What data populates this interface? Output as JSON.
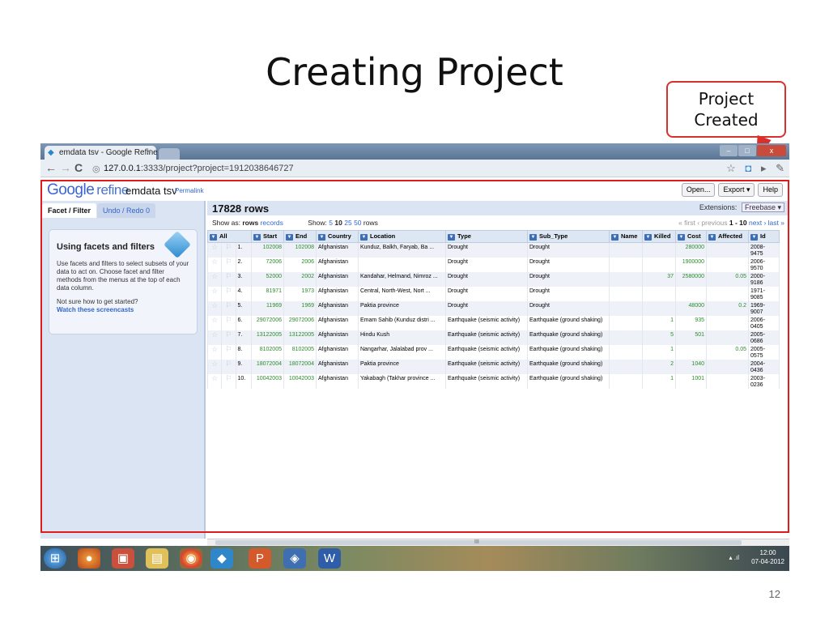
{
  "slide": {
    "title": "Creating Project",
    "callout": "Project Created",
    "page_number": "12"
  },
  "browser": {
    "tab_title": "emdata tsv - Google Refine",
    "tab_close": "×",
    "url_host": "127.0.0.1",
    "url_rest": ":3333/project?project=1912038646727"
  },
  "refine": {
    "logo": "Google",
    "logo_suffix": "refine",
    "project_name": "emdata tsv",
    "permalink": "Permalink",
    "buttons": {
      "open": "Open...",
      "export": "Export ▾",
      "help": "Help"
    },
    "left_tabs": {
      "facet": "Facet / Filter",
      "undo": "Undo / Redo 0"
    },
    "facet_box": {
      "title": "Using facets and filters",
      "text1": "Use facets and filters to select subsets of your data to act on. Choose facet and filter methods from the menus at the top of each data column.",
      "text2": "Not sure how to get started?",
      "link": "Watch these screencasts"
    },
    "row_count": "17828 rows",
    "extensions_label": "Extensions:",
    "extensions_value": "Freebase ▾",
    "show_as_label": "Show as:",
    "show_as_rows": "rows",
    "show_as_records": "records",
    "show_label": "Show:",
    "page_sizes": [
      "5",
      "10",
      "25",
      "50"
    ],
    "page_size_selected": "10",
    "rows_word": "rows",
    "pager": {
      "first": "« first",
      "previous": "‹ previous",
      "range": "1 - 10",
      "next": "next ›",
      "last": "last »"
    },
    "columns": [
      "All",
      "Start",
      "End",
      "Country",
      "Location",
      "Type",
      "Sub_Type",
      "Name",
      "Killed",
      "Cost",
      "Affected",
      "Id"
    ],
    "rows": [
      {
        "n": "1.",
        "start": "102008",
        "end": "102008",
        "country": "Afghanistan",
        "location": "Kunduz, Balkh, Faryab, Ba ...",
        "type": "Drought",
        "subtype": "Drought",
        "name": "",
        "killed": "",
        "cost": "280000",
        "affected": "",
        "id": [
          "2008-",
          "9475"
        ]
      },
      {
        "n": "2.",
        "start": "72006",
        "end": "2006",
        "country": "Afghanistan",
        "location": "",
        "type": "Drought",
        "subtype": "Drought",
        "name": "",
        "killed": "",
        "cost": "1900000",
        "affected": "",
        "id": [
          "2006-",
          "9570"
        ]
      },
      {
        "n": "3.",
        "start": "52000",
        "end": "2002",
        "country": "Afghanistan",
        "location": "Kandahar, Helmand, Nimroz ...",
        "type": "Drought",
        "subtype": "Drought",
        "name": "",
        "killed": "37",
        "cost": "2580000",
        "affected": "0.05",
        "id": [
          "2000-",
          "9186"
        ]
      },
      {
        "n": "4.",
        "start": "81971",
        "end": "1973",
        "country": "Afghanistan",
        "location": "Central, North-West, Nort ...",
        "type": "Drought",
        "subtype": "Drought",
        "name": "",
        "killed": "",
        "cost": "",
        "affected": "",
        "id": [
          "1971-",
          "9085"
        ]
      },
      {
        "n": "5.",
        "start": "11969",
        "end": "1969",
        "country": "Afghanistan",
        "location": "Paktia province",
        "type": "Drought",
        "subtype": "Drought",
        "name": "",
        "killed": "",
        "cost": "48000",
        "affected": "0.2",
        "id": [
          "1969-",
          "9007"
        ]
      },
      {
        "n": "6.",
        "start": "29072006",
        "end": "29072006",
        "country": "Afghanistan",
        "location": "Emam Sahib (Kunduz distri ...",
        "type": "Earthquake (seismic activity)",
        "subtype": "Earthquake (ground shaking)",
        "name": "",
        "killed": "1",
        "cost": "935",
        "affected": "",
        "id": [
          "2006-",
          "0405"
        ]
      },
      {
        "n": "7.",
        "start": "13122005",
        "end": "13122005",
        "country": "Afghanistan",
        "location": "Hindu Kush",
        "type": "Earthquake (seismic activity)",
        "subtype": "Earthquake (ground shaking)",
        "name": "",
        "killed": "5",
        "cost": "501",
        "affected": "",
        "id": [
          "2005-",
          "0686"
        ]
      },
      {
        "n": "8.",
        "start": "8102005",
        "end": "8102005",
        "country": "Afghanistan",
        "location": "Nangarhar, Jalalabad prov ...",
        "type": "Earthquake (seismic activity)",
        "subtype": "Earthquake (ground shaking)",
        "name": "",
        "killed": "1",
        "cost": "",
        "affected": "0.05",
        "id": [
          "2005-",
          "0575"
        ]
      },
      {
        "n": "9.",
        "start": "18072004",
        "end": "18072004",
        "country": "Afghanistan",
        "location": "Paktia province",
        "type": "Earthquake (seismic activity)",
        "subtype": "Earthquake (ground shaking)",
        "name": "",
        "killed": "2",
        "cost": "1040",
        "affected": "",
        "id": [
          "2004-",
          "0436"
        ]
      },
      {
        "n": "10.",
        "start": "10042003",
        "end": "10042003",
        "country": "Afghanistan",
        "location": "Yakabagh (Takhar province ...",
        "type": "Earthquake (seismic activity)",
        "subtype": "Earthquake (ground shaking)",
        "name": "",
        "killed": "1",
        "cost": "1001",
        "affected": "",
        "id": [
          "2003-",
          "0236"
        ]
      }
    ],
    "scrollbar_label": "III"
  },
  "taskbar": {
    "time": "12:00",
    "date": "07-04-2012",
    "apps": [
      "windows-start-icon",
      "firefox-icon",
      "picture-viewer-icon",
      "explorer-folder-icon",
      "chrome-icon",
      "refine-icon",
      "powerpoint-icon",
      "media-icon",
      "word-icon"
    ]
  },
  "colors": {
    "highlight": "#e01b1b",
    "callout_border": "#d9302c",
    "link": "#3366cc",
    "number": "#2c8a2c"
  }
}
